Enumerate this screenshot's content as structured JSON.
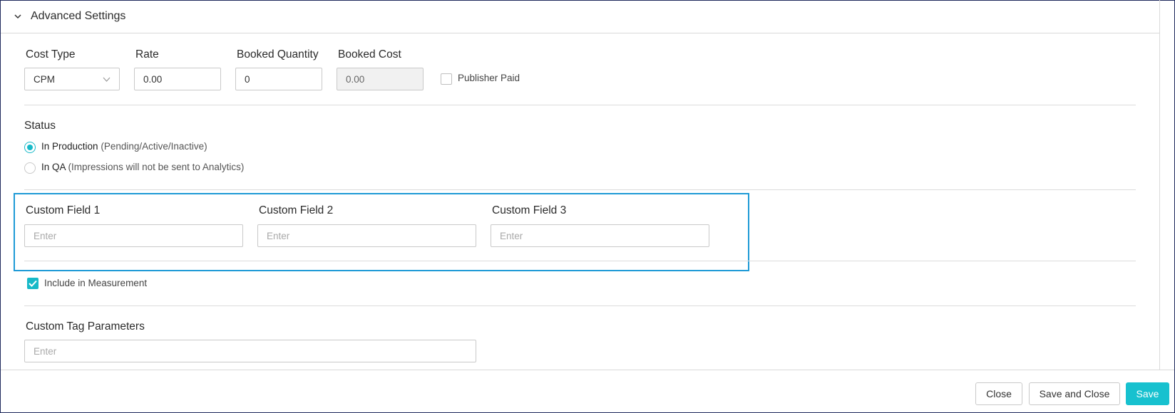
{
  "section": {
    "title": "Advanced Settings"
  },
  "cost": {
    "cost_type_label": "Cost Type",
    "cost_type_value": "CPM",
    "rate_label": "Rate",
    "rate_value": "0.00",
    "booked_quantity_label": "Booked Quantity",
    "booked_quantity_value": "0",
    "booked_cost_label": "Booked Cost",
    "booked_cost_value": "0.00",
    "publisher_paid_label": "Publisher Paid",
    "publisher_paid_checked": false
  },
  "status": {
    "label": "Status",
    "options": [
      {
        "label": "In Production",
        "note": "(Pending/Active/Inactive)",
        "selected": true
      },
      {
        "label": "In QA",
        "note": "(Impressions will not be sent to Analytics)",
        "selected": false
      }
    ]
  },
  "custom_fields": [
    {
      "label": "Custom Field 1",
      "placeholder": "Enter",
      "value": ""
    },
    {
      "label": "Custom Field 2",
      "placeholder": "Enter",
      "value": ""
    },
    {
      "label": "Custom Field 3",
      "placeholder": "Enter",
      "value": ""
    }
  ],
  "measurement": {
    "label": "Include in Measurement",
    "checked": true
  },
  "custom_tag": {
    "label": "Custom Tag Parameters",
    "placeholder": "Enter",
    "value": ""
  },
  "footer": {
    "close_label": "Close",
    "save_close_label": "Save and Close",
    "save_label": "Save"
  },
  "colors": {
    "accent": "#17c1cf",
    "highlight_border": "#1e9ad6",
    "frame": "#1f2a5c"
  }
}
